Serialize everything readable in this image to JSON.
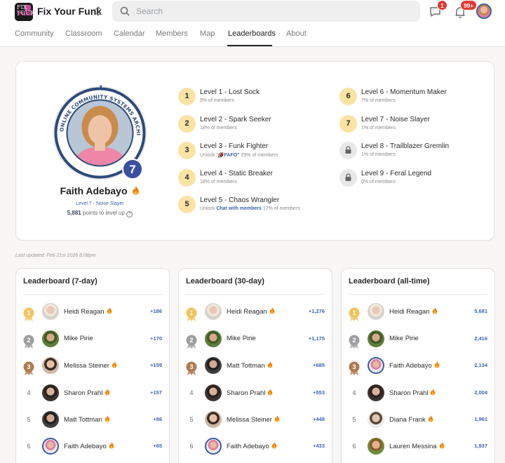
{
  "header": {
    "logo_line1": "FIX YOUR",
    "logo_line2": "Funk",
    "app_name": "Fix Your Funk",
    "search_placeholder": "Search",
    "chat_badge": "1",
    "notif_badge": "99+"
  },
  "tabs": [
    "Community",
    "Classroom",
    "Calendar",
    "Members",
    "Map",
    "Leaderboards",
    "About"
  ],
  "active_tab": "Leaderboards",
  "profile": {
    "name": "Faith Adebayo",
    "ring_text": "ONLINE COMMUNITY SYSTEMS ARCHITECT",
    "level_number": "7",
    "level_label": "Level 7 - Noise Slayer",
    "points_value": "5,881",
    "points_suffix": "points to level up"
  },
  "levels": [
    {
      "badge": "1",
      "title": "Level 1 - Lost Sock",
      "sub": "9% of members",
      "locked": false
    },
    {
      "badge": "2",
      "title": "Level 2 - Spark Seeker",
      "sub": "18% of members",
      "locked": false
    },
    {
      "badge": "3",
      "title": "Level 3 - Funk Fighter",
      "sub_prefix": "Unlock \"",
      "sub_link": "FAFO\"",
      "sub": "29% of members",
      "locked": false
    },
    {
      "badge": "4",
      "title": "Level 4 - Static Breaker",
      "sub": "18% of members",
      "locked": false
    },
    {
      "badge": "5",
      "title": "Level 5 - Chaos Wrangler",
      "sub_prefix": "Unlock ",
      "sub_link": "Chat with members",
      "sub": "17% of members",
      "locked": false
    },
    {
      "badge": "6",
      "title": "Level 6 - Momentum Maker",
      "sub": "7% of members",
      "locked": false
    },
    {
      "badge": "7",
      "title": "Level 7 - Noise Slayer",
      "sub": "1% of members",
      "locked": false
    },
    {
      "badge": "",
      "title": "Level 8 - Trailblazer Gremlin",
      "sub": "1% of members",
      "locked": true
    },
    {
      "badge": "",
      "title": "Level 9 - Feral Legend",
      "sub": "0% of members",
      "locked": true
    }
  ],
  "last_updated": "Last updated: Feb 21st 2026 8:08pm",
  "leaderboards": [
    {
      "title": "Leaderboard (7-day)",
      "rows": [
        {
          "rank": "1",
          "name": "Heidi Reagan",
          "points": "+186"
        },
        {
          "rank": "2",
          "name": "Mike Pirie",
          "points": "+170"
        },
        {
          "rank": "3",
          "name": "Melissa Steiner",
          "points": "+159"
        },
        {
          "rank": "4",
          "name": "Sharon Prahl",
          "points": "+157"
        },
        {
          "rank": "5",
          "name": "Matt Tottman",
          "points": "+86"
        },
        {
          "rank": "6",
          "name": "Faith Adebayo",
          "points": "+65"
        }
      ]
    },
    {
      "title": "Leaderboard (30-day)",
      "rows": [
        {
          "rank": "1",
          "name": "Heidi Reagan",
          "points": "+1,276"
        },
        {
          "rank": "2",
          "name": "Mike Pirie",
          "points": "+1,175"
        },
        {
          "rank": "3",
          "name": "Matt Tottman",
          "points": "+685"
        },
        {
          "rank": "4",
          "name": "Sharon Prahl",
          "points": "+553"
        },
        {
          "rank": "5",
          "name": "Melissa Steiner",
          "points": "+448"
        },
        {
          "rank": "6",
          "name": "Faith Adebayo",
          "points": "+433"
        }
      ]
    },
    {
      "title": "Leaderboard (all-time)",
      "rows": [
        {
          "rank": "1",
          "name": "Heidi Reagan",
          "points": "5,681"
        },
        {
          "rank": "2",
          "name": "Mike Pirie",
          "points": "2,416"
        },
        {
          "rank": "3",
          "name": "Faith Adebayo",
          "points": "2,134"
        },
        {
          "rank": "4",
          "name": "Sharon Prahl",
          "points": "2,004"
        },
        {
          "rank": "5",
          "name": "Diana Frank",
          "points": "1,961"
        },
        {
          "rank": "6",
          "name": "Lauren Messina",
          "points": "1,937"
        }
      ]
    }
  ],
  "colors": {
    "accent_blue": "#3d63b3",
    "level_badge": "#3b4fa0",
    "level_circle": "#fbe3a4",
    "gold": "#f3c35c",
    "silver": "#9e9e9e",
    "bronze": "#b07a4f",
    "notification_red": "#e53935",
    "flame": "#f57c00"
  },
  "icons": {
    "search": "search-icon",
    "chat": "chat-icon",
    "bell": "bell-icon",
    "switch": "chevron-updown-icon",
    "lock": "lock-icon",
    "flame": "flame-icon",
    "help": "help-icon",
    "medal": "medal-icon"
  }
}
